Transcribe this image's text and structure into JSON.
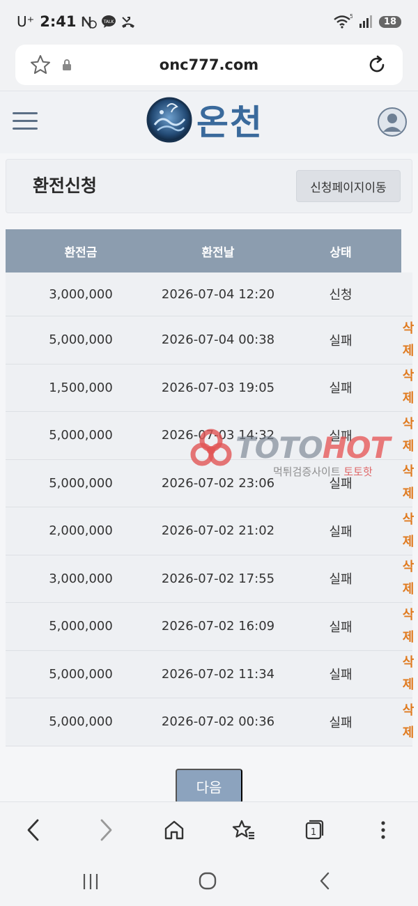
{
  "status_bar": {
    "carrier": "U⁺",
    "time": "2:41",
    "battery": "18"
  },
  "browser": {
    "url": "onc777.com"
  },
  "site": {
    "logo_text": "온천"
  },
  "page": {
    "title": "환전신청",
    "move_button": "신청페이지이동"
  },
  "table": {
    "headers": [
      "환전금",
      "환전날",
      "상태"
    ],
    "rows": [
      {
        "amount": "3,000,000",
        "date": "2026-07-04 12:20",
        "status": "신청",
        "action": ""
      },
      {
        "amount": "5,000,000",
        "date": "2026-07-04 00:38",
        "status": "실패",
        "action": "삭제"
      },
      {
        "amount": "1,500,000",
        "date": "2026-07-03 19:05",
        "status": "실패",
        "action": "삭제"
      },
      {
        "amount": "5,000,000",
        "date": "2026-07-03 14:32",
        "status": "실패",
        "action": "삭제"
      },
      {
        "amount": "5,000,000",
        "date": "2026-07-02 23:06",
        "status": "실패",
        "action": "삭제"
      },
      {
        "amount": "2,000,000",
        "date": "2026-07-02 21:02",
        "status": "실패",
        "action": "삭제"
      },
      {
        "amount": "3,000,000",
        "date": "2026-07-02 17:55",
        "status": "실패",
        "action": "삭제"
      },
      {
        "amount": "5,000,000",
        "date": "2026-07-02 16:09",
        "status": "실패",
        "action": "삭제"
      },
      {
        "amount": "5,000,000",
        "date": "2026-07-02 11:34",
        "status": "실패",
        "action": "삭제"
      },
      {
        "amount": "5,000,000",
        "date": "2026-07-02 00:36",
        "status": "실패",
        "action": "삭제"
      }
    ],
    "delete_chars": [
      "삭",
      "제"
    ]
  },
  "pagination": {
    "next_label": "다음"
  },
  "watermark": {
    "brand_a": "TOTO",
    "brand_b": "HOT",
    "sub_a": "먹튀검증사이트",
    "sub_b": "토토핫"
  },
  "colors": {
    "header_bg": "#8c9daf",
    "delete_text": "#e07a1e",
    "next_button": "#8ca3be",
    "logo": "#3a6a9c"
  },
  "icons": [
    "star-icon",
    "lock-icon",
    "reload-icon",
    "menu-icon",
    "user-avatar-icon",
    "back-icon",
    "forward-icon",
    "home-icon",
    "bookmarks-icon",
    "tabs-icon",
    "more-icon",
    "recent-apps-icon",
    "home-circle-icon",
    "nav-back-icon"
  ]
}
